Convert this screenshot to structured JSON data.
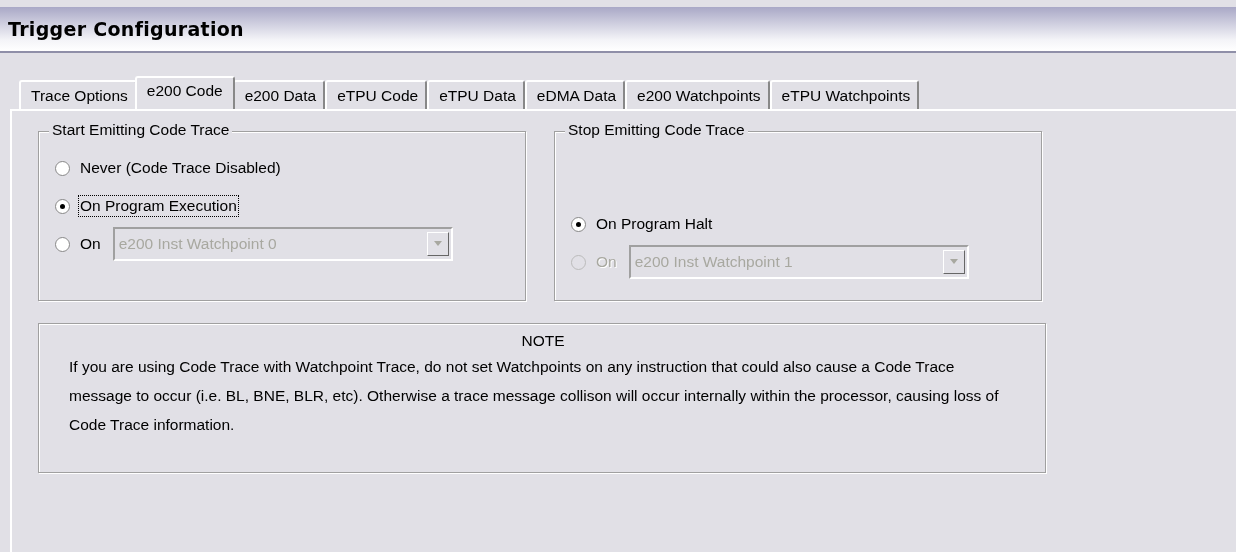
{
  "window": {
    "title": "Trigger Configuration"
  },
  "tabs": [
    {
      "label": "Trace Options",
      "selected": false
    },
    {
      "label": "e200 Code",
      "selected": true
    },
    {
      "label": "e200 Data",
      "selected": false
    },
    {
      "label": "eTPU Code",
      "selected": false
    },
    {
      "label": "eTPU Data",
      "selected": false
    },
    {
      "label": "eDMA Data",
      "selected": false
    },
    {
      "label": "e200 Watchpoints",
      "selected": false
    },
    {
      "label": "eTPU Watchpoints",
      "selected": false
    }
  ],
  "groups": [
    {
      "title": "Start Emitting Code Trace",
      "options": [
        {
          "label": "Never (Code Trace Disabled)",
          "selected": false,
          "disabled": false,
          "focused": false
        },
        {
          "label": "On Program Execution",
          "selected": true,
          "disabled": false,
          "focused": true
        },
        {
          "label": "On",
          "selected": false,
          "disabled": false,
          "focused": false,
          "combo": {
            "value": "e200 Inst Watchpoint 0",
            "disabled": true
          }
        }
      ]
    },
    {
      "title": "Stop Emitting Code Trace",
      "options": [
        {
          "label": "On Program Halt",
          "selected": true,
          "disabled": false,
          "focused": false
        },
        {
          "label": "On",
          "selected": false,
          "disabled": true,
          "focused": false,
          "combo": {
            "value": "e200 Inst Watchpoint 1",
            "disabled": true
          }
        }
      ]
    }
  ],
  "note": {
    "heading": "NOTE",
    "text": "If you are using Code Trace with Watchpoint Trace, do not set Watchpoints on any instruction that could also cause a Code Trace message to occur (i.e. BL, BNE, BLR, etc). Otherwise a trace message collison will occur internally within the processor, causing loss of Code Trace information."
  }
}
